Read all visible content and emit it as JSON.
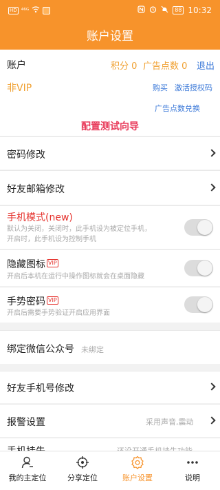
{
  "status_bar": {
    "left_badge": "HD",
    "signal": "⁴⁶ᴳ",
    "battery": "88",
    "time": "10:32"
  },
  "header": {
    "title": "账户设置"
  },
  "account": {
    "label": "账户",
    "points": "积分 0",
    "ad_points": "广告点数 0",
    "logout": "退出",
    "vip_status": "非VIP",
    "buy": "购买",
    "activate": "激活授权码",
    "exchange": "广告点数兑换",
    "wizard": "配置测试向导"
  },
  "settings": {
    "password": "密码修改",
    "friend_email": "好友邮箱修改",
    "phone_mode": {
      "label": "手机模式(new)",
      "desc_line1": "默认为关闭，关闭时，此手机设为被定位手机，",
      "desc_line2": "开启时，此手机设为控制手机",
      "enabled": false
    },
    "hide_icon": {
      "label": "隐藏图标",
      "badge": "VIP",
      "desc": "开启后本机在运行中操作图标就会在桌面隐藏",
      "enabled": false
    },
    "gesture": {
      "label": "手势密码",
      "badge": "VIP",
      "desc": "开启后需要手势验证开启应用界面",
      "enabled": false
    },
    "wechat": {
      "label": "绑定微信公众号",
      "value": "未绑定"
    },
    "friend_phone": "好友手机号修改",
    "alarm": {
      "label": "报警设置",
      "value": "采用声音,震动"
    },
    "phone_hang": {
      "label": "手机挂失",
      "value": "还没开通手机挂失功能"
    }
  },
  "tabs": [
    {
      "label": "我的主定位",
      "icon": "person-icon",
      "active": false
    },
    {
      "label": "分享定位",
      "icon": "crosshair-icon",
      "active": false
    },
    {
      "label": "账户设置",
      "icon": "gear-icon",
      "active": true
    },
    {
      "label": "说明",
      "icon": "more-dots-icon",
      "active": false
    }
  ],
  "colors": {
    "primary": "#f7932b",
    "link": "#3a78d8",
    "accent_red": "#e5322d",
    "wizard": "#e83a5a"
  }
}
